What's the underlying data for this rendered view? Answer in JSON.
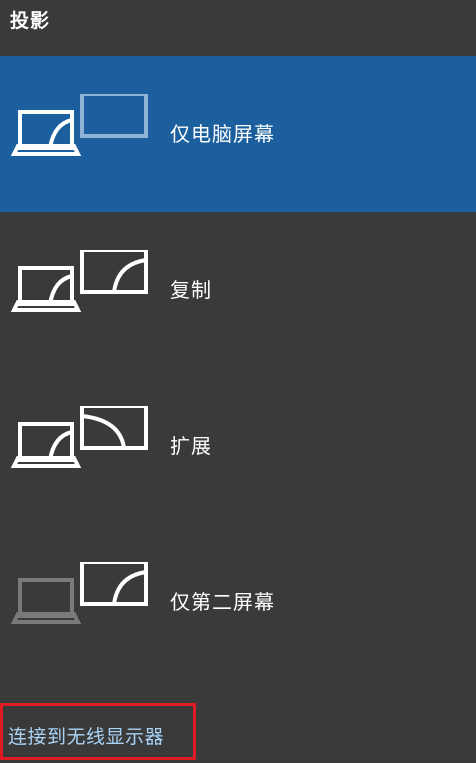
{
  "panel": {
    "title": "投影"
  },
  "options": [
    {
      "label": "仅电脑屏幕",
      "icon": "pc-screen-only-icon",
      "selected": true
    },
    {
      "label": "复制",
      "icon": "duplicate-icon",
      "selected": false
    },
    {
      "label": "扩展",
      "icon": "extend-icon",
      "selected": false
    },
    {
      "label": "仅第二屏幕",
      "icon": "second-screen-only-icon",
      "selected": false
    }
  ],
  "connect": {
    "label": "连接到无线显示器"
  },
  "colors": {
    "background": "#3a3a3a",
    "selected": "#1b5f9e",
    "link": "#a9d3f5",
    "highlight_border": "#e01b24"
  }
}
